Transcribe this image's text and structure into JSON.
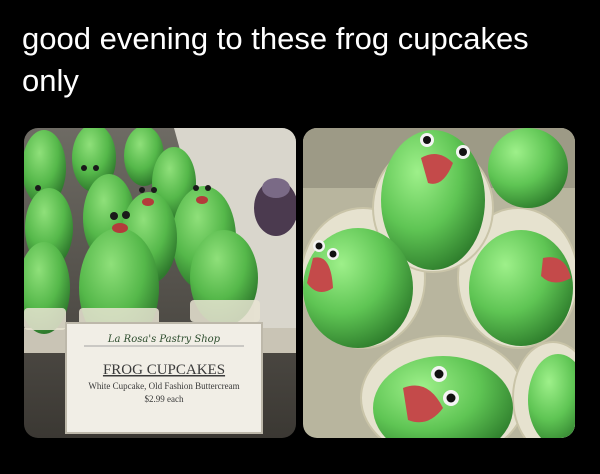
{
  "post": {
    "caption": "good evening to these frog cupcakes only"
  },
  "sign": {
    "shop_name": "La Rosa's Pastry Shop",
    "title": "FROG CUPCAKES",
    "description": "White Cupcake, Old Fashion Buttercream",
    "price": "$2.99 each"
  }
}
